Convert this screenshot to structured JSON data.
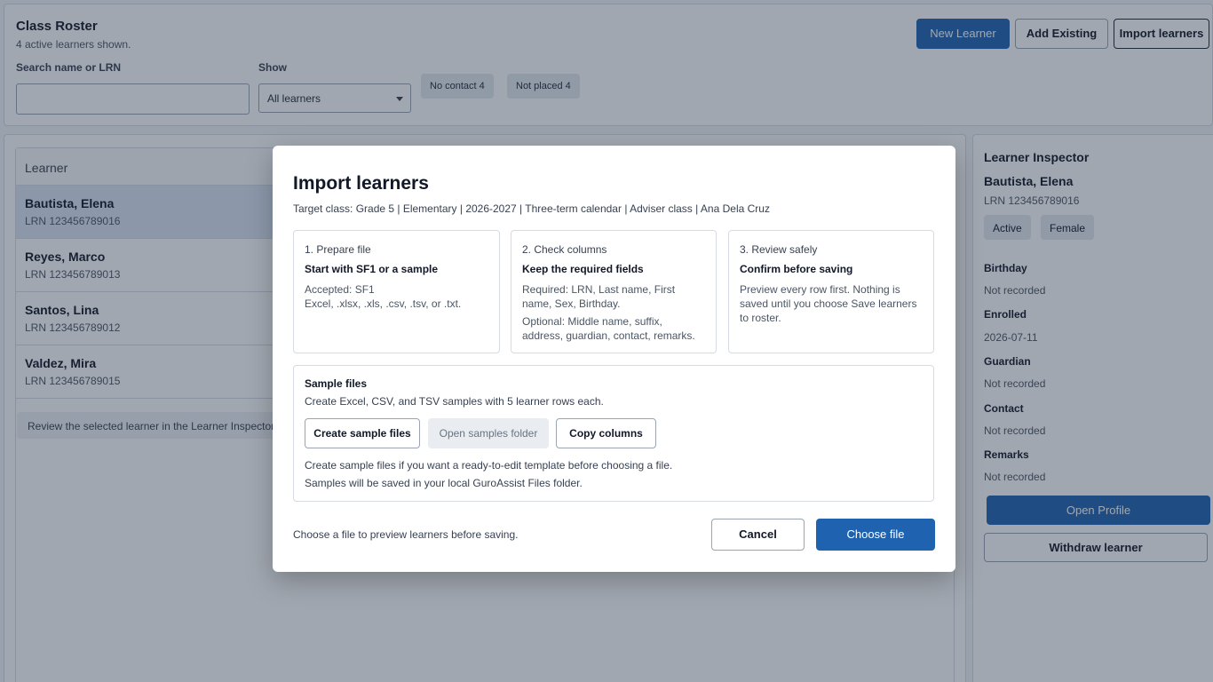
{
  "header": {
    "title": "Class Roster",
    "subtitle": "4 active learners shown.",
    "search_label": "Search name or LRN",
    "search_value": "",
    "show_label": "Show",
    "show_selected": "All learners",
    "chips": [
      "No contact 4",
      "Not placed 4"
    ],
    "buttons": {
      "new": "New Learner",
      "add": "Add Existing",
      "import": "Import learners"
    }
  },
  "roster": {
    "column_header": "Learner",
    "rows": [
      {
        "name": "Bautista, Elena",
        "lrn": "LRN 123456789016"
      },
      {
        "name": "Reyes, Marco",
        "lrn": "LRN 123456789013"
      },
      {
        "name": "Santos, Lina",
        "lrn": "LRN 123456789012"
      },
      {
        "name": "Valdez, Mira",
        "lrn": "LRN 123456789015"
      }
    ],
    "hint": "Review the selected learner in the Learner Inspector."
  },
  "inspector": {
    "title": "Learner Inspector",
    "name": "Bautista, Elena",
    "lrn": "LRN 123456789016",
    "badges": [
      "Active",
      "Female"
    ],
    "fields": [
      {
        "label": "Birthday",
        "value": "Not recorded"
      },
      {
        "label": "Enrolled",
        "value": "2026-07-11"
      },
      {
        "label": "Guardian",
        "value": "Not recorded"
      },
      {
        "label": "Contact",
        "value": "Not recorded"
      },
      {
        "label": "Remarks",
        "value": "Not recorded"
      }
    ],
    "open_profile": "Open Profile",
    "withdraw": "Withdraw learner"
  },
  "modal": {
    "title": "Import learners",
    "target": "Target class: Grade 5 | Elementary | 2026-2027 | Three-term calendar | Adviser class | Ana Dela Cruz",
    "steps": [
      {
        "heading": "1. Prepare file",
        "bold": "Start with SF1 or a sample",
        "text1": "Accepted: SF1",
        "text2": "Excel, .xlsx, .xls, .csv, .tsv, or .txt."
      },
      {
        "heading": "2. Check columns",
        "bold": "Keep the required fields",
        "text1": "Required: LRN, Last name, First name, Sex, Birthday.",
        "text2": "Optional: Middle name, suffix, address, guardian, contact, remarks."
      },
      {
        "heading": "3. Review safely",
        "bold": "Confirm before saving",
        "text1": "Preview every row first. Nothing is saved until you choose Save learners to roster.",
        "text2": ""
      }
    ],
    "samples": {
      "heading": "Sample files",
      "description": "Create Excel, CSV, and TSV samples with 5 learner rows each.",
      "create": "Create sample files",
      "open_folder": "Open samples folder",
      "copy": "Copy columns",
      "note1": "Create sample files if you want a ready-to-edit template before choosing a file.",
      "note2": "Samples will be saved in your local GuroAssist Files folder."
    },
    "footer_text": "Choose a file to preview learners before saving.",
    "cancel": "Cancel",
    "choose": "Choose file"
  },
  "colors": {
    "primary": "#1f63b0",
    "overlay": "rgba(31,45,66,0.42)"
  }
}
